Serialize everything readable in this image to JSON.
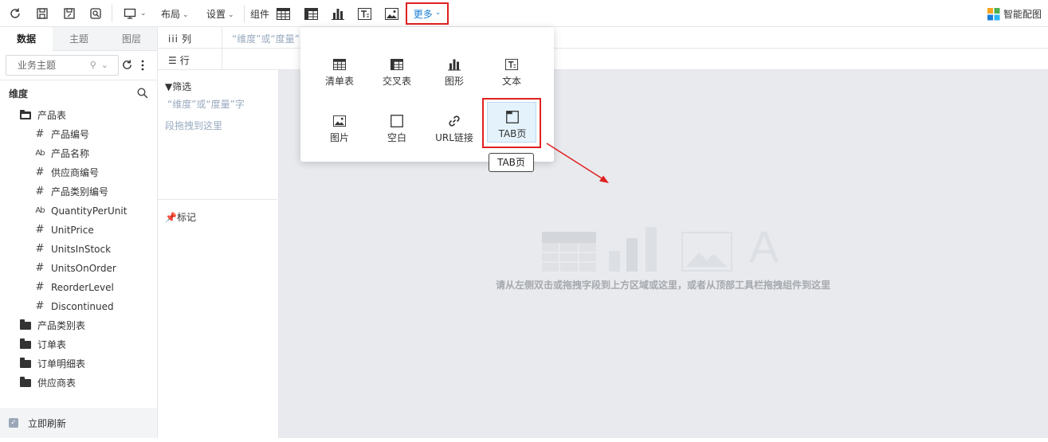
{
  "toolbar": {
    "layout_label": "布局",
    "settings_label": "设置",
    "components_label": "组件",
    "more_label": "更多",
    "smart_chart_label": "智能配图"
  },
  "left_panel": {
    "tabs": [
      "数据",
      "主题",
      "图层"
    ],
    "subject_placeholder": "业务主题",
    "dimension_label": "维度",
    "tables": [
      {
        "name": "产品表",
        "expanded": true,
        "fields": [
          {
            "type": "number",
            "name": "产品编号"
          },
          {
            "type": "text",
            "name": "产品名称"
          },
          {
            "type": "number",
            "name": "供应商编号"
          },
          {
            "type": "number",
            "name": "产品类别编号"
          },
          {
            "type": "text",
            "name": "QuantityPerUnit"
          },
          {
            "type": "number",
            "name": "UnitPrice"
          },
          {
            "type": "number",
            "name": "UnitsInStock"
          },
          {
            "type": "number",
            "name": "UnitsOnOrder"
          },
          {
            "type": "number",
            "name": "ReorderLevel"
          },
          {
            "type": "number",
            "name": "Discontinued"
          }
        ]
      },
      {
        "name": "产品类别表"
      },
      {
        "name": "订单表"
      },
      {
        "name": "订单明细表"
      },
      {
        "name": "供应商表"
      }
    ],
    "refresh_label": "立即刷新"
  },
  "shelves": {
    "columns_label": "列",
    "rows_label": "行",
    "columns_hint": "“维度”或“度量”"
  },
  "mid_panel": {
    "filter_label": "筛选",
    "filter_hint_line1": "“维度”或“度量”字",
    "filter_hint_line2": "段拖拽到这里",
    "marks_label": "标记"
  },
  "canvas": {
    "hint": "请从左侧双击或拖拽字段到上方区域或这里，或者从顶部工具栏拖拽组件到这里"
  },
  "dropdown": {
    "items": [
      {
        "icon": "table-icon",
        "label": "清单表"
      },
      {
        "icon": "crosstab-icon",
        "label": "交叉表"
      },
      {
        "icon": "chart-icon",
        "label": "图形"
      },
      {
        "icon": "text-icon",
        "label": "文本"
      },
      {
        "icon": "image-icon",
        "label": "图片"
      },
      {
        "icon": "blank-icon",
        "label": "空白"
      },
      {
        "icon": "link-icon",
        "label": "URL链接"
      },
      {
        "icon": "tab-page-icon",
        "label": "TAB页"
      }
    ],
    "tooltip": "TAB页"
  },
  "colors": {
    "accent": "#1a7fd6",
    "highlight": "#e02020",
    "canvas_bg": "#e8eaee",
    "hint_text": "#99aabf"
  }
}
